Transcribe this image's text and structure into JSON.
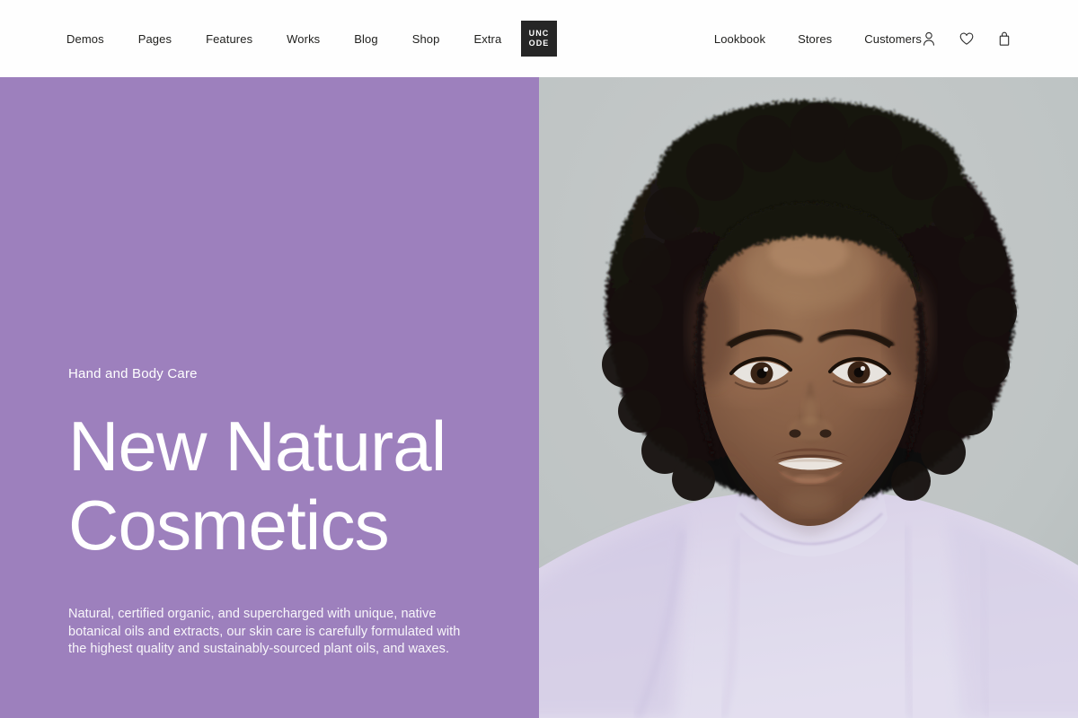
{
  "header": {
    "nav_left": [
      {
        "label": "Demos"
      },
      {
        "label": "Pages"
      },
      {
        "label": "Features"
      },
      {
        "label": "Works"
      },
      {
        "label": "Blog"
      },
      {
        "label": "Shop"
      },
      {
        "label": "Extra"
      }
    ],
    "logo": {
      "line1": "UNC",
      "line2": "ODE",
      "background": "#262626",
      "text_color": "#ffffff"
    },
    "nav_right": [
      {
        "label": "Lookbook"
      },
      {
        "label": "Stores"
      },
      {
        "label": "Customers"
      }
    ],
    "icons": [
      {
        "name": "account-icon",
        "title": "Account"
      },
      {
        "name": "wishlist-heart-icon",
        "title": "Wishlist"
      },
      {
        "name": "cart-bag-icon",
        "title": "Cart"
      }
    ],
    "background": "#fefefe",
    "text_color": "#21211f"
  },
  "hero": {
    "eyebrow": "Hand and Body Care",
    "headline_line1": "New Natural",
    "headline_line2": "Cosmetics",
    "body": "Natural, certified organic, and supercharged with unique, native botanical oils and extracts, our skin care is carefully formulated with the highest quality and sustainably-sourced plant oils, and waxes.",
    "panel_color": "#9d80bd",
    "text_color": "#ffffff",
    "image": {
      "alt": "Portrait of a woman with an afro wearing a lavender turtleneck",
      "background_color": "#c7cdcd",
      "garment_color": "#e2dcf0",
      "hair_color": "#16120f",
      "skin_color": "#8a6149"
    }
  }
}
